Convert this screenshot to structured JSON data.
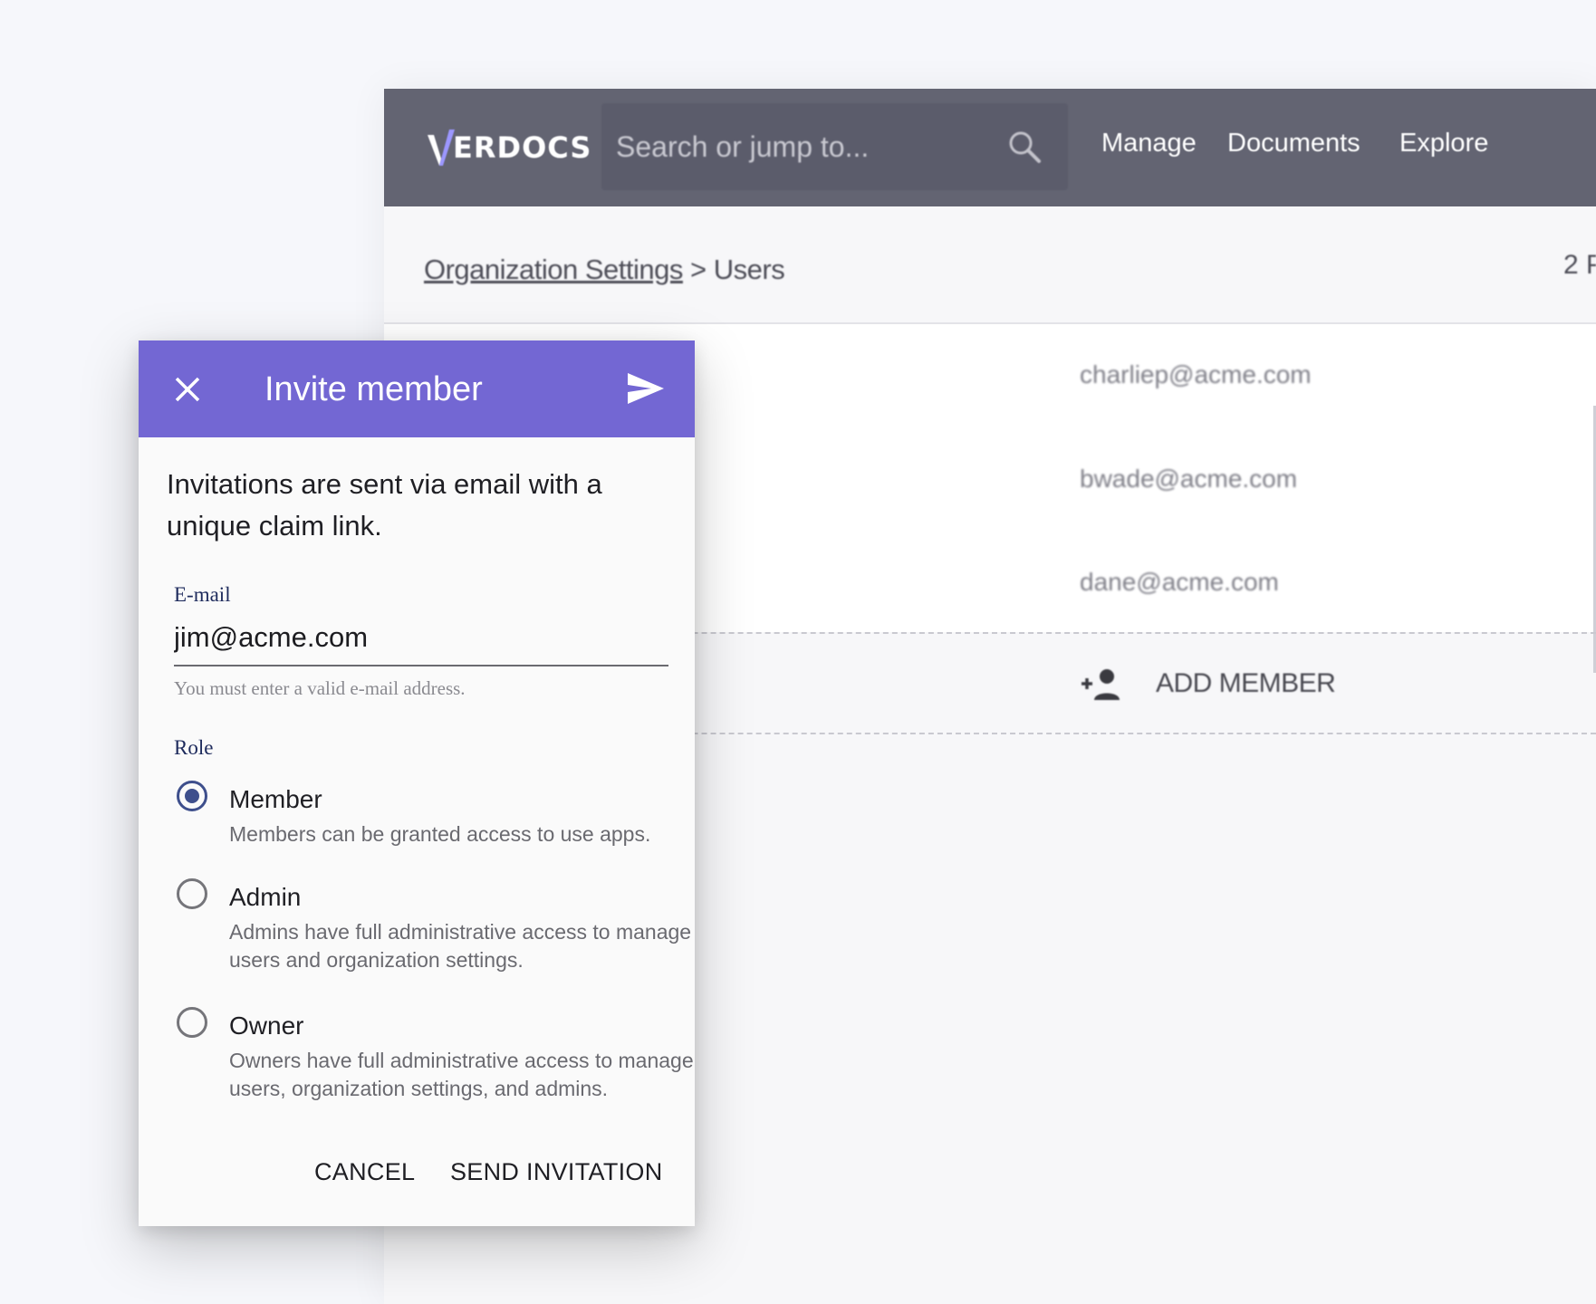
{
  "app": {
    "logo": {
      "text": "ERDOCS"
    },
    "search": {
      "placeholder": "Search or jump to..."
    },
    "nav": {
      "manage": "Manage",
      "documents": "Documents",
      "explore": "Explore"
    },
    "breadcrumb": {
      "parent": "Organization Settings",
      "separator": ">",
      "current": "Users"
    },
    "page_indicator": "2 P",
    "users": [
      {
        "email": "charliep@acme.com"
      },
      {
        "email": "bwade@acme.com"
      },
      {
        "email": "dane@acme.com"
      }
    ],
    "add_member_label": "ADD MEMBER"
  },
  "dialog": {
    "title": "Invite member",
    "intro": "Invitations are sent via email with a unique claim link.",
    "email": {
      "label": "E-mail",
      "value": "jim@acme.com",
      "hint": "You must enter a valid e-mail address."
    },
    "role": {
      "label": "Role",
      "selected": "Member",
      "options": [
        {
          "title": "Member",
          "description": "Members can be granted access to use apps."
        },
        {
          "title": "Admin",
          "description": "Admins have full administrative access to manage users and organization settings."
        },
        {
          "title": "Owner",
          "description": "Owners have full administrative access to manage users, organization settings, and admins."
        }
      ]
    },
    "buttons": {
      "cancel": "CANCEL",
      "send": "SEND INVITATION"
    }
  },
  "colors": {
    "topbar": "#636472",
    "dialog_header": "#7367d3",
    "radio_selected": "#3e4f8c",
    "page_background": "#f6f7fb"
  },
  "icons": [
    "v-logo-icon",
    "search-icon",
    "close-icon",
    "send-icon",
    "add-person-icon"
  ]
}
